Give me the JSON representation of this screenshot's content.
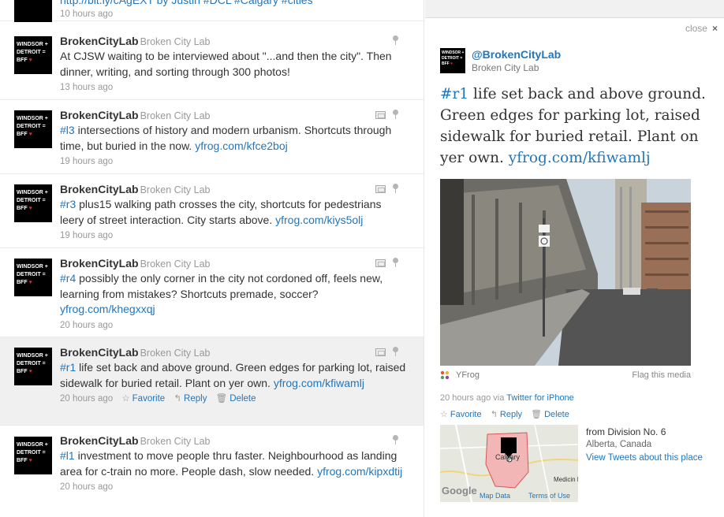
{
  "avatar": {
    "line1": "WINDSOR +",
    "line2": "DETROIT =",
    "line3": "BFF",
    "heart": "♥"
  },
  "timeline": {
    "top_partial": {
      "text": "http://bit.ly/cAgEXT by Justin #DCL #Calgary #cities",
      "time": "10 hours ago"
    },
    "tweets": [
      {
        "username": "BrokenCityLab",
        "realname": "Broken City Lab",
        "text": "At CJSW waiting to be interviewed about \"...and then the city\". Then dinner, writing, and sorting through 300 photos!",
        "time": "13 hours ago",
        "photo": false
      },
      {
        "username": "BrokenCityLab",
        "realname": "Broken City Lab",
        "hashtag": "#l3",
        "text": " intersections of history and modern urbanism. Shortcuts through time, but buried in the now. ",
        "link": "yfrog.com/kfce2boj",
        "time": "19 hours ago",
        "photo": true
      },
      {
        "username": "BrokenCityLab",
        "realname": "Broken City Lab",
        "hashtag": "#r3",
        "text": " plus15 walking path crosses the city, shortcuts for pedestrians leery of street interaction. City starts above. ",
        "link": "yfrog.com/kiys5olj",
        "time": "19 hours ago",
        "photo": true
      },
      {
        "username": "BrokenCityLab",
        "realname": "Broken City Lab",
        "hashtag": "#r4",
        "text": " possibly the only corner in the city not cordoned off, feels new, learning from mistakes? Shortcuts premade, soccer? ",
        "link": "yfrog.com/khegxxqj",
        "time": "20 hours ago",
        "photo": true
      },
      {
        "username": "BrokenCityLab",
        "realname": "Broken City Lab",
        "hashtag": "#r1",
        "text": " life set back and above ground. Green edges for parking lot, raised sidewalk for buried retail. Plant on yer own. ",
        "link": "yfrog.com/kfiwamlj",
        "time": "20 hours ago",
        "photo": true,
        "actions": {
          "favorite": "Favorite",
          "reply": "Reply",
          "delete": "Delete"
        }
      },
      {
        "username": "BrokenCityLab",
        "realname": "Broken City Lab",
        "hashtag": "#l1",
        "text": " investment to move people thru faster. Neighbourhood as landing area for c-train no more. People dash, slow needed. ",
        "link": "yfrog.com/kipxdtij",
        "time": "20 hours ago",
        "photo": false
      }
    ]
  },
  "details": {
    "close_label": "close",
    "close_x": "×",
    "handle": "@BrokenCityLab",
    "realname": "Broken City Lab",
    "hashtag": "#r1",
    "text": " life set back and above ground. Green edges for parking lot, raised sidewalk for buried retail. Plant on yer own. ",
    "link": "yfrog.com/kfiwamlj",
    "media_source": "YFrog",
    "flag_media": "Flag this media",
    "time": "20 hours ago via ",
    "via": "Twitter for iPhone",
    "actions": {
      "favorite": "Favorite",
      "reply": "Reply",
      "delete": "Delete"
    },
    "location": {
      "from": "from Division No. 6",
      "region": "Alberta, Canada",
      "view_link": "View Tweets about this place"
    },
    "map": {
      "google": "Google",
      "map_data": "Map Data",
      "terms": "Terms of Use",
      "city": "Calgary",
      "city_partial": "Medicin Hat"
    }
  },
  "colors": {
    "link": "#2276bb",
    "selected_bg": "#f0f0f0",
    "pane_bg": "#f1f1f1"
  }
}
